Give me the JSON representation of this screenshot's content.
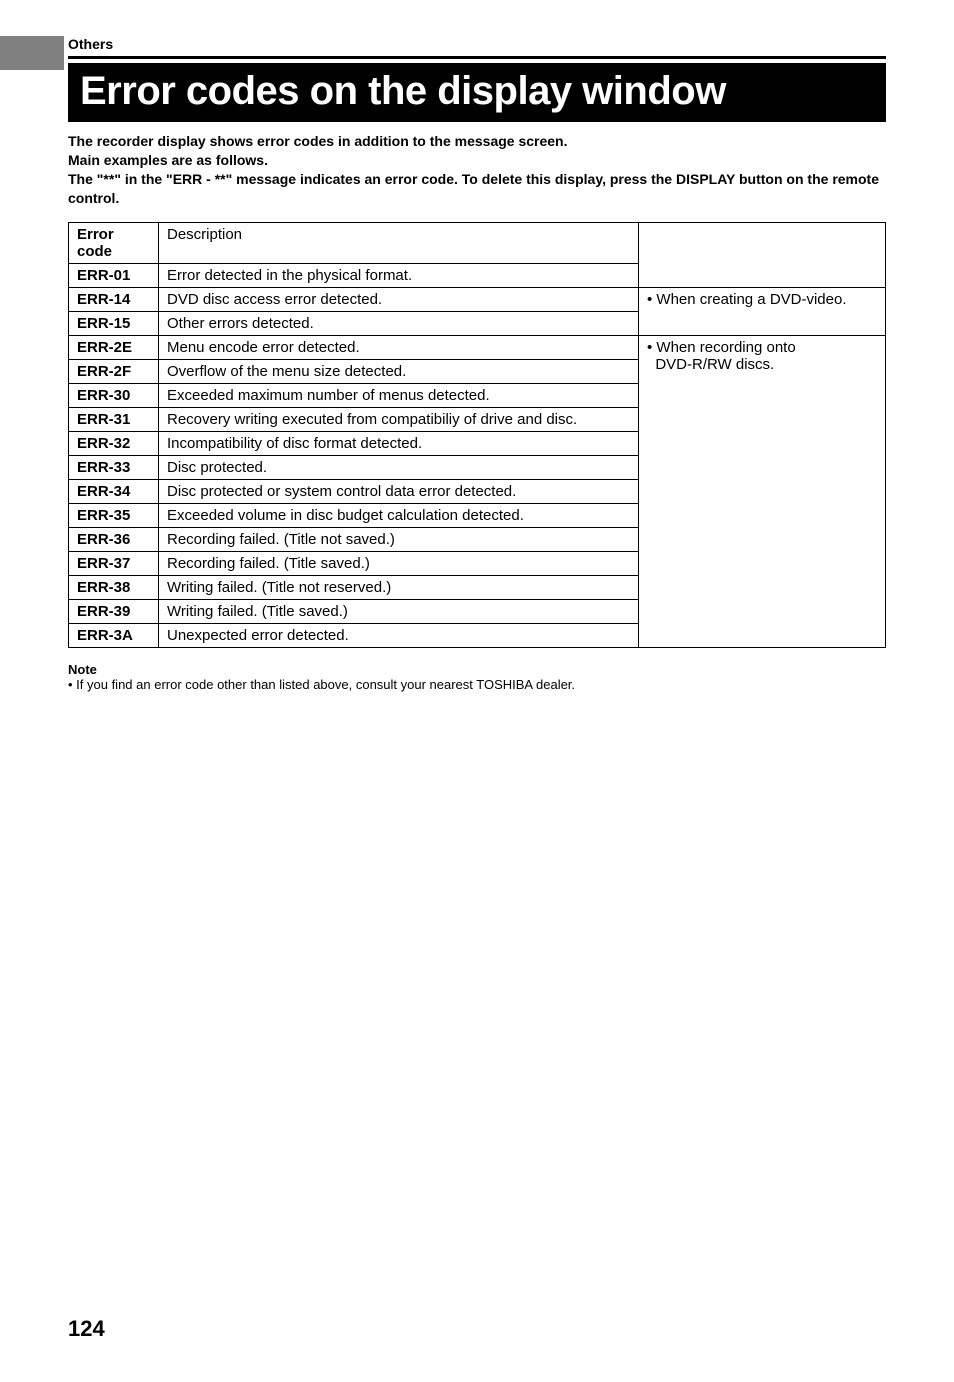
{
  "section_label": "Others",
  "title": "Error codes on the display window",
  "intro": {
    "line1": "The recorder display shows error codes in addition to the message screen.",
    "line2": "Main examples are as follows.",
    "line3": "The \"**\" in the \"ERR - **\" message indicates an error code. To delete this display, press the DISPLAY button on the remote control."
  },
  "table": {
    "headers": {
      "code": "Error code",
      "desc": "Description",
      "context": ""
    },
    "groups": [
      {
        "context": "• When creating a DVD-video.",
        "rows": [
          {
            "code": "ERR-01",
            "desc": "Error detected in the physical format.",
            "blank_context": true
          },
          {
            "code": "ERR-14",
            "desc": "DVD disc access error detected."
          },
          {
            "code": "ERR-15",
            "desc": "Other errors detected."
          }
        ]
      },
      {
        "context": "• When recording onto\n  DVD-R/RW discs.",
        "rows": [
          {
            "code": "ERR-2E",
            "desc": "Menu encode error detected."
          },
          {
            "code": "ERR-2F",
            "desc": "Overflow of the menu size detected."
          },
          {
            "code": "ERR-30",
            "desc": "Exceeded maximum number of menus detected."
          },
          {
            "code": "ERR-31",
            "desc": "Recovery writing executed from compatibiliy of drive and disc."
          },
          {
            "code": "ERR-32",
            "desc": "Incompatibility of disc format detected."
          },
          {
            "code": "ERR-33",
            "desc": "Disc protected."
          },
          {
            "code": "ERR-34",
            "desc": "Disc protected or system control data error detected."
          },
          {
            "code": "ERR-35",
            "desc": "Exceeded volume in disc budget calculation detected."
          },
          {
            "code": "ERR-36",
            "desc": "Recording failed. (Title not saved.)"
          },
          {
            "code": "ERR-37",
            "desc": "Recording failed. (Title saved.)"
          },
          {
            "code": "ERR-38",
            "desc": "Writing failed. (Title not reserved.)"
          },
          {
            "code": "ERR-39",
            "desc": "Writing failed. (Title saved.)"
          },
          {
            "code": "ERR-3A",
            "desc": "Unexpected error detected."
          }
        ]
      }
    ]
  },
  "note": {
    "label": "Note",
    "text": "• If you find an error code other than listed above, consult your nearest TOSHIBA dealer."
  },
  "page_number": "124"
}
